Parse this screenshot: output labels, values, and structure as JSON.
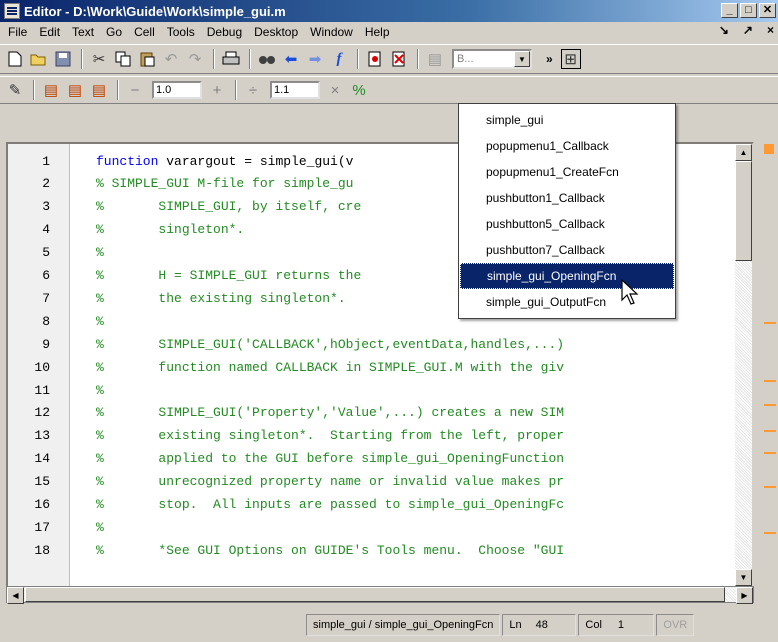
{
  "window": {
    "title": "Editor - D:\\Work\\Guide\\Work\\simple_gui.m"
  },
  "menu": [
    "File",
    "Edit",
    "Text",
    "Go",
    "Cell",
    "Tools",
    "Debug",
    "Desktop",
    "Window",
    "Help"
  ],
  "menu_right": [
    "↘",
    "↗",
    "×"
  ],
  "toolbar1": {
    "icons": [
      "new-file-icon",
      "open-icon",
      "save-icon",
      "cut-icon",
      "copy-icon",
      "paste-icon",
      "undo-icon",
      "redo-icon",
      "print-icon",
      "find-icon",
      "back-icon",
      "forward-icon",
      "function-icon",
      "set-breakpoint-icon",
      "clear-breakpoint-icon",
      "step-icon"
    ],
    "stack_combo": "B...",
    "overflow": "»"
  },
  "toolbar2": {
    "minus": "−",
    "value1": "1.0",
    "plus": "+",
    "divide": "÷",
    "value2": "1.1",
    "times": "×",
    "percent": "%"
  },
  "function_list": {
    "items": [
      "simple_gui",
      "popupmenu1_Callback",
      "popupmenu1_CreateFcn",
      "pushbutton1_Callback",
      "pushbutton5_Callback",
      "pushbutton7_Callback",
      "simple_gui_OpeningFcn",
      "simple_gui_OutputFcn"
    ],
    "selected": "simple_gui_OpeningFcn"
  },
  "editor": {
    "lines": [
      {
        "n": "1",
        "text": "function varargout = simple_gui(v",
        "kw": true
      },
      {
        "n": "2",
        "text": "% SIMPLE_GUI M-file for simple_gu",
        "kw": false
      },
      {
        "n": "3",
        "text": "%       SIMPLE_GUI, by itself, cre              I or r",
        "kw": false
      },
      {
        "n": "4",
        "text": "%       singleton*.",
        "kw": false
      },
      {
        "n": "5",
        "text": "%",
        "kw": false
      },
      {
        "n": "6",
        "text": "%       H = SIMPLE_GUI returns the              PLE_GU",
        "kw": false
      },
      {
        "n": "7",
        "text": "%       the existing singleton*.",
        "kw": false
      },
      {
        "n": "8",
        "text": "%",
        "kw": false
      },
      {
        "n": "9",
        "text": "%       SIMPLE_GUI('CALLBACK',hObject,eventData,handles,...)",
        "kw": false
      },
      {
        "n": "10",
        "text": "%       function named CALLBACK in SIMPLE_GUI.M with the giv",
        "kw": false
      },
      {
        "n": "11",
        "text": "%",
        "kw": false
      },
      {
        "n": "12",
        "text": "%       SIMPLE_GUI('Property','Value',...) creates a new SIM",
        "kw": false
      },
      {
        "n": "13",
        "text": "%       existing singleton*.  Starting from the left, proper",
        "kw": false
      },
      {
        "n": "14",
        "text": "%       applied to the GUI before simple_gui_OpeningFunction",
        "kw": false
      },
      {
        "n": "15",
        "text": "%       unrecognized property name or invalid value makes pr",
        "kw": false
      },
      {
        "n": "16",
        "text": "%       stop.  All inputs are passed to simple_gui_OpeningFc",
        "kw": false
      },
      {
        "n": "17",
        "text": "%",
        "kw": false
      },
      {
        "n": "18",
        "text": "%       *See GUI Options on GUIDE's Tools menu.  Choose \"GUI",
        "kw": false
      }
    ]
  },
  "status": {
    "function": "simple_gui / simple_gui_OpeningFcn",
    "ln_label": "Ln",
    "ln": "48",
    "col_label": "Col",
    "col": "1",
    "ovr": "OVR"
  }
}
